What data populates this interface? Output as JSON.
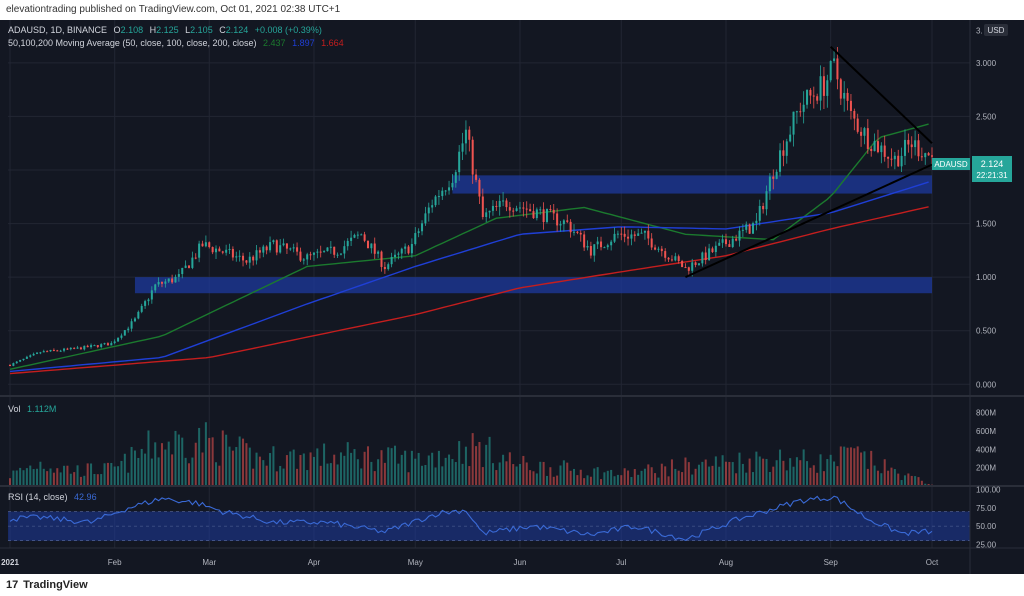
{
  "header": {
    "published": "elevationtrading published on TradingView.com, Oct 01, 2021 02:38 UTC+1"
  },
  "legend": {
    "symbol": "ADAUSD, 1D, BINANCE",
    "o_label": "O",
    "o_value": "2.108",
    "h_label": "H",
    "h_value": "2.125",
    "l_label": "L",
    "l_value": "2.105",
    "c_label": "C",
    "c_value": "2.124",
    "change": "+0.008 (+0.39%)",
    "ma_label": "50,100,200 Moving Average (50, close, 100, close, 200, close)",
    "ma50_value": "2.437",
    "ma100_value": "1.897",
    "ma200_value": "1.664"
  },
  "price_axis": {
    "currency": "USD",
    "ticks": [
      "3.",
      "3.000",
      "2.500",
      "2.000",
      "1.500",
      "1.000",
      "0.500",
      "0.000"
    ],
    "last_label": "ADAUSD",
    "last_price": "2.124",
    "countdown": "22:21:31"
  },
  "volume": {
    "label": "Vol",
    "value": "1.112M",
    "ticks": [
      "800M",
      "600M",
      "400M",
      "200M"
    ]
  },
  "rsi": {
    "label": "RSI (14, close)",
    "value": "42.96",
    "ticks": [
      "100.00",
      "75.00",
      "50.00",
      "25.00"
    ]
  },
  "time_axis": {
    "labels": [
      "2021",
      "Feb",
      "Mar",
      "Apr",
      "May",
      "Jun",
      "Jul",
      "Aug",
      "Sep",
      "Oct"
    ]
  },
  "footer": {
    "brand": "TradingView",
    "logo_mark": "17"
  },
  "colors": {
    "up": "#26a69a",
    "down": "#ef5350",
    "ma50": "#1b7a2e",
    "ma100": "#1f3fd6",
    "ma200": "#c41e1e",
    "zone": "#1e3a9e",
    "rsi_line": "#3a6ad6",
    "rsi_band": "#1e3a9e",
    "bg": "#131722",
    "grid": "#222633",
    "axis_text": "#b2b5be",
    "trendline": "#000000"
  },
  "chart_data": [
    {
      "type": "candlestick",
      "title": "ADAUSD, 1D, BINANCE",
      "x_unit": "date",
      "x_range": [
        "2021-01-01",
        "2021-10-01"
      ],
      "ylim": [
        -0.1,
        3.4
      ],
      "y_ticks": [
        0,
        0.5,
        1.0,
        1.5,
        2.0,
        2.5,
        3.0
      ],
      "grid": true,
      "last_close": 2.124,
      "price_anchors": [
        [
          "2021-01-01",
          0.18
        ],
        [
          "2021-01-10",
          0.3
        ],
        [
          "2021-01-20",
          0.33
        ],
        [
          "2021-01-31",
          0.38
        ],
        [
          "2021-02-07",
          0.6
        ],
        [
          "2021-02-13",
          0.92
        ],
        [
          "2021-02-20",
          1.0
        ],
        [
          "2021-02-27",
          1.3
        ],
        [
          "2021-03-04",
          1.25
        ],
        [
          "2021-03-12",
          1.15
        ],
        [
          "2021-03-20",
          1.3
        ],
        [
          "2021-03-30",
          1.18
        ],
        [
          "2021-04-08",
          1.25
        ],
        [
          "2021-04-15",
          1.4
        ],
        [
          "2021-04-22",
          1.1
        ],
        [
          "2021-04-30",
          1.3
        ],
        [
          "2021-05-06",
          1.7
        ],
        [
          "2021-05-12",
          1.95
        ],
        [
          "2021-05-16",
          2.35
        ],
        [
          "2021-05-21",
          1.55
        ],
        [
          "2021-05-28",
          1.7
        ],
        [
          "2021-06-05",
          1.62
        ],
        [
          "2021-06-15",
          1.5
        ],
        [
          "2021-06-22",
          1.25
        ],
        [
          "2021-06-30",
          1.4
        ],
        [
          "2021-07-08",
          1.38
        ],
        [
          "2021-07-20",
          1.08
        ],
        [
          "2021-07-31",
          1.3
        ],
        [
          "2021-08-10",
          1.5
        ],
        [
          "2021-08-15",
          2.0
        ],
        [
          "2021-08-23",
          2.6
        ],
        [
          "2021-08-30",
          2.8
        ],
        [
          "2021-09-02",
          2.95
        ],
        [
          "2021-09-07",
          2.5
        ],
        [
          "2021-09-12",
          2.3
        ],
        [
          "2021-09-20",
          2.1
        ],
        [
          "2021-09-25",
          2.25
        ],
        [
          "2021-10-01",
          2.124
        ]
      ],
      "series": [
        {
          "name": "50",
          "anchors": [
            [
              "2021-01-01",
              0.14
            ],
            [
              "2021-02-15",
              0.45
            ],
            [
              "2021-03-30",
              1.1
            ],
            [
              "2021-05-01",
              1.2
            ],
            [
              "2021-05-25",
              1.55
            ],
            [
              "2021-06-20",
              1.65
            ],
            [
              "2021-07-20",
              1.4
            ],
            [
              "2021-08-15",
              1.35
            ],
            [
              "2021-09-01",
              1.75
            ],
            [
              "2021-09-15",
              2.3
            ],
            [
              "2021-10-01",
              2.437
            ]
          ]
        },
        {
          "name": "100",
          "anchors": [
            [
              "2021-01-01",
              0.12
            ],
            [
              "2021-02-15",
              0.25
            ],
            [
              "2021-03-30",
              0.75
            ],
            [
              "2021-05-01",
              1.1
            ],
            [
              "2021-06-01",
              1.4
            ],
            [
              "2021-07-01",
              1.47
            ],
            [
              "2021-08-01",
              1.45
            ],
            [
              "2021-09-01",
              1.6
            ],
            [
              "2021-10-01",
              1.897
            ]
          ]
        },
        {
          "name": "200",
          "anchors": [
            [
              "2021-01-01",
              0.1
            ],
            [
              "2021-03-01",
              0.25
            ],
            [
              "2021-05-01",
              0.65
            ],
            [
              "2021-06-01",
              0.9
            ],
            [
              "2021-07-01",
              1.05
            ],
            [
              "2021-08-01",
              1.2
            ],
            [
              "2021-09-01",
              1.45
            ],
            [
              "2021-10-01",
              1.664
            ]
          ]
        }
      ],
      "zones": [
        {
          "x_start": "2021-05-12",
          "x_end": "2021-10-01",
          "y_low": 1.78,
          "y_high": 1.95
        },
        {
          "x_start": "2021-02-07",
          "x_end": "2021-10-01",
          "y_low": 0.85,
          "y_high": 1.0
        }
      ],
      "trendlines": [
        {
          "x1": "2021-07-20",
          "y1": 1.0,
          "x2": "2021-10-01",
          "y2": 2.05
        },
        {
          "x1": "2021-09-01",
          "y1": 3.15,
          "x2": "2021-10-01",
          "y2": 2.25
        }
      ]
    },
    {
      "type": "bar",
      "title": "Vol",
      "ylim": [
        0,
        850
      ],
      "y_ticks": [
        200,
        400,
        600,
        800
      ],
      "unit": "M",
      "last_value_m": 1.112,
      "volume_anchors": [
        [
          "2021-01-01",
          120
        ],
        [
          "2021-01-10",
          250
        ],
        [
          "2021-01-20",
          170
        ],
        [
          "2021-02-01",
          180
        ],
        [
          "2021-02-13",
          450
        ],
        [
          "2021-02-27",
          500
        ],
        [
          "2021-03-15",
          300
        ],
        [
          "2021-04-15",
          330
        ],
        [
          "2021-05-01",
          280
        ],
        [
          "2021-05-19",
          420
        ],
        [
          "2021-06-01",
          230
        ],
        [
          "2021-07-01",
          130
        ],
        [
          "2021-07-21",
          220
        ],
        [
          "2021-08-15",
          300
        ],
        [
          "2021-09-01",
          250
        ],
        [
          "2021-09-07",
          350
        ],
        [
          "2021-09-20",
          150
        ],
        [
          "2021-10-01",
          20
        ]
      ]
    },
    {
      "type": "line",
      "title": "RSI (14, close)",
      "ylim": [
        20,
        105
      ],
      "y_ticks": [
        25,
        50,
        75,
        100
      ],
      "band": [
        30,
        70
      ],
      "last_value": 42.96,
      "rsi_anchors": [
        [
          "2021-01-01",
          60
        ],
        [
          "2021-01-10",
          62
        ],
        [
          "2021-01-25",
          55
        ],
        [
          "2021-02-05",
          75
        ],
        [
          "2021-02-15",
          88
        ],
        [
          "2021-02-25",
          82
        ],
        [
          "2021-03-05",
          70
        ],
        [
          "2021-03-20",
          55
        ],
        [
          "2021-04-05",
          55
        ],
        [
          "2021-04-22",
          42
        ],
        [
          "2021-05-08",
          68
        ],
        [
          "2021-05-16",
          72
        ],
        [
          "2021-05-21",
          40
        ],
        [
          "2021-06-05",
          50
        ],
        [
          "2021-06-22",
          38
        ],
        [
          "2021-07-05",
          50
        ],
        [
          "2021-07-20",
          32
        ],
        [
          "2021-08-05",
          60
        ],
        [
          "2021-08-23",
          85
        ],
        [
          "2021-09-02",
          90
        ],
        [
          "2021-09-12",
          60
        ],
        [
          "2021-09-22",
          40
        ],
        [
          "2021-10-01",
          42.96
        ]
      ]
    }
  ]
}
